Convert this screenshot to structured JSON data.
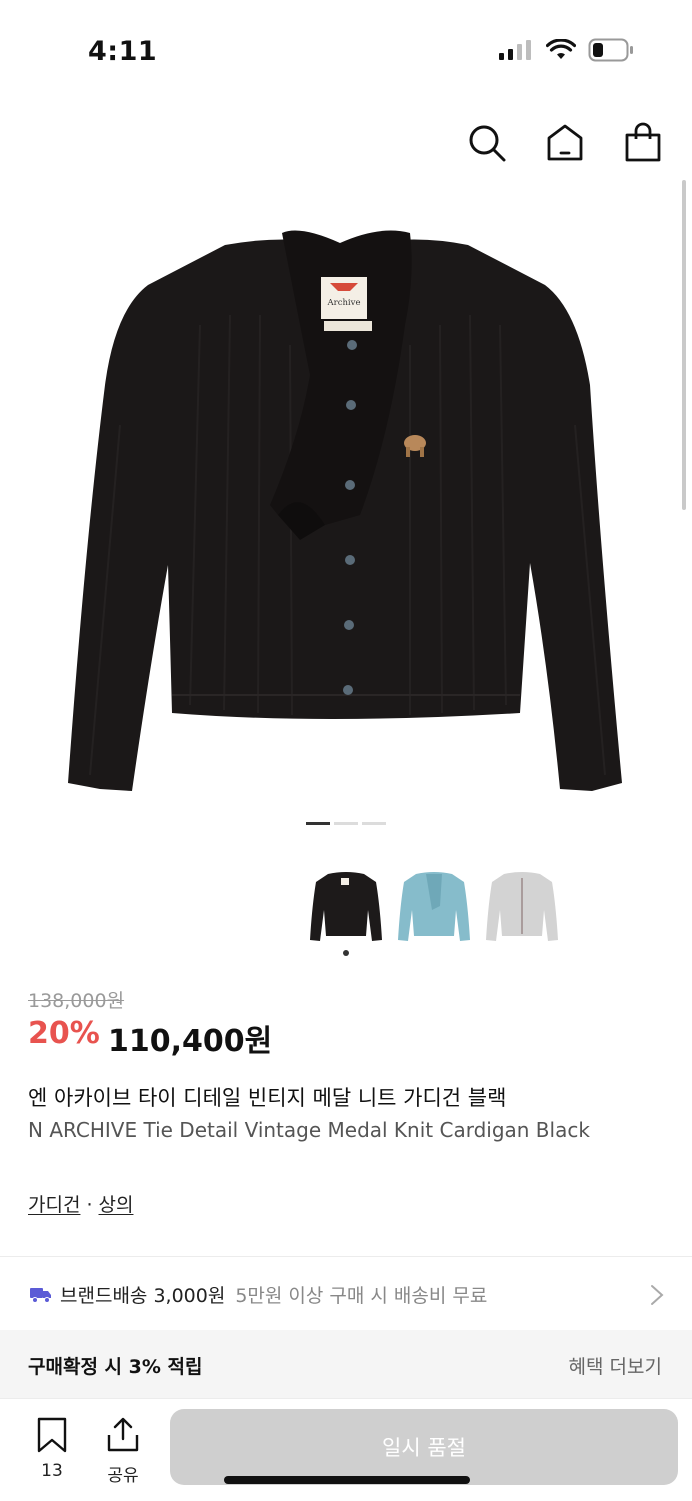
{
  "status_bar": {
    "time": "4:11"
  },
  "header": {
    "icons": [
      "search-icon",
      "home-icon",
      "shopping-bag-icon"
    ]
  },
  "product": {
    "original_price": "138,000원",
    "discount": "20%",
    "sale_price": "110,400원",
    "title_ko": "엔 아카이브 타이 디테일 빈티지 메달 니트 가디건 블랙",
    "title_en": "N ARCHIVE Tie Detail Vintage Medal Knit Cardigan Black",
    "label_brand": "Archive",
    "categories": [
      "가디건",
      "상의"
    ],
    "category_separator": "·",
    "image_pagination": {
      "total": 3,
      "active": 1
    },
    "colors": [
      {
        "name": "black",
        "hex": "#1d1a1a",
        "selected": true
      },
      {
        "name": "sky-blue",
        "hex": "#86bccb",
        "selected": false
      },
      {
        "name": "light-gray",
        "hex": "#d3d3d3",
        "selected": false
      }
    ]
  },
  "shipping": {
    "main": "브랜드배송 3,000원",
    "sub": "5만원 이상 구매 시 배송비 무료"
  },
  "benefit": {
    "left": "구매확정 시 3% 적립",
    "right": "혜택 더보기"
  },
  "bottom_bar": {
    "wish_count": "13",
    "share_label": "공유",
    "soldout_label": "일시 품절"
  },
  "colors": {
    "accent_discount": "#e8534f",
    "ship_icon": "#5b5bd6",
    "disabled_button": "#cfcfcf"
  }
}
